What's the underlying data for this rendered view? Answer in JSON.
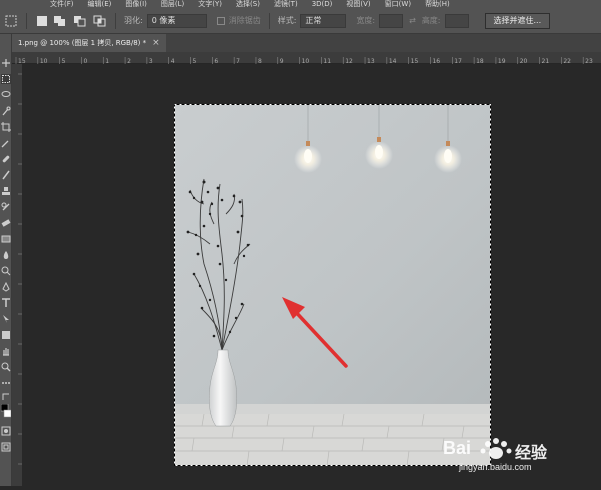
{
  "menubar": {
    "items": [
      "文件(F)",
      "编辑(E)",
      "图像(I)",
      "图层(L)",
      "文字(Y)",
      "选择(S)",
      "滤镜(T)",
      "3D(D)",
      "视图(V)",
      "窗口(W)",
      "帮助(H)"
    ]
  },
  "options": {
    "feather_label": "羽化:",
    "feather_value": "0 像素",
    "antialias_label": "消除锯齿",
    "style_label": "样式:",
    "style_value": "正常",
    "width_label": "宽度:",
    "height_label": "高度:",
    "select_mask_button": "选择并遮住..."
  },
  "document_tab": {
    "title": "1.png @ 100% (图层 1 拷贝, RGB/8) *",
    "close": "×"
  },
  "ruler_top": {
    "ticks": [
      "15",
      "10",
      "5",
      "0",
      "1",
      "2",
      "3",
      "4",
      "5",
      "6",
      "7",
      "8",
      "9",
      "10",
      "11",
      "12",
      "13",
      "14",
      "15",
      "16",
      "17",
      "18",
      "19",
      "20",
      "21",
      "22",
      "23"
    ]
  },
  "watermark": {
    "brand": "Bai",
    "brand_cn": "经验",
    "url": "jingyan.baidu.com"
  },
  "colors": {
    "ui_dark": "#282828",
    "ui_panel": "#535353",
    "arrow": "#e03030",
    "wall": "#c3c7c9",
    "floor": "#d8d8d6"
  }
}
